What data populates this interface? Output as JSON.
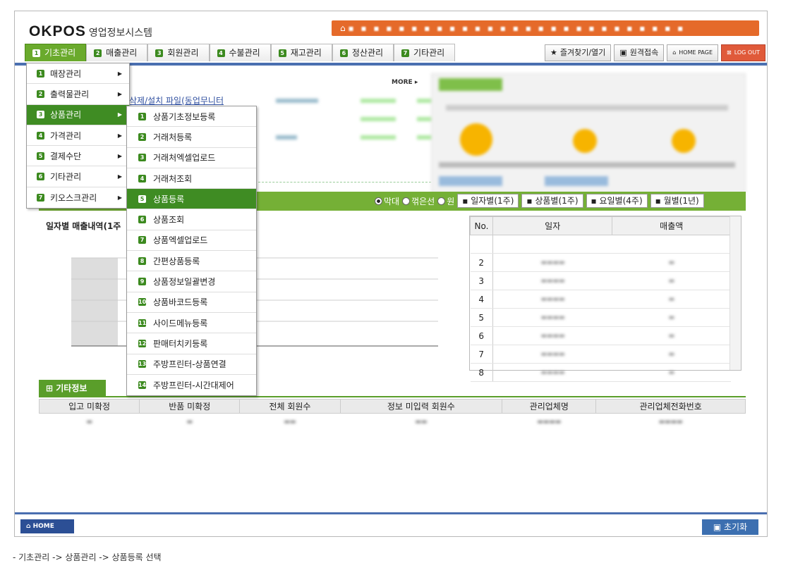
{
  "header": {
    "logo": "OKPOS",
    "subtitle": "영업정보시스템",
    "notice": "▪ ▪ ▪ ▪ ▪ ▪ ▪ ▪ ▪ ▪ ▪ ▪ ▪ ▪ ▪ ▪ ▪ ▪ ▪ ▪ ▪ ▪ ▪ ▪ ▪ ▪ ▪"
  },
  "tabs": [
    {
      "num": "1",
      "label": "기초관리"
    },
    {
      "num": "2",
      "label": "매출관리"
    },
    {
      "num": "3",
      "label": "회원관리"
    },
    {
      "num": "4",
      "label": "수불관리"
    },
    {
      "num": "5",
      "label": "재고관리"
    },
    {
      "num": "6",
      "label": "정산관리"
    },
    {
      "num": "7",
      "label": "기타관리"
    }
  ],
  "toolbar": {
    "favorites": "즐겨찾기/열기",
    "remote": "원격접속",
    "homepage": "HOME PAGE",
    "logout": "LOG OUT"
  },
  "menu1": [
    {
      "num": "1",
      "label": "매장관리"
    },
    {
      "num": "2",
      "label": "출력물관리"
    },
    {
      "num": "3",
      "label": "상품관리"
    },
    {
      "num": "4",
      "label": "가격관리"
    },
    {
      "num": "5",
      "label": "결제수단"
    },
    {
      "num": "6",
      "label": "기타관리"
    },
    {
      "num": "7",
      "label": "키오스크관리"
    }
  ],
  "menu2": [
    {
      "num": "1",
      "label": "상품기초정보등록"
    },
    {
      "num": "2",
      "label": "거래처등록"
    },
    {
      "num": "3",
      "label": "거래처엑셀업로드"
    },
    {
      "num": "4",
      "label": "거래처조회"
    },
    {
      "num": "5",
      "label": "상품등록"
    },
    {
      "num": "6",
      "label": "상품조회"
    },
    {
      "num": "7",
      "label": "상품엑셀업로드"
    },
    {
      "num": "8",
      "label": "간편상품등록"
    },
    {
      "num": "9",
      "label": "상품정보일괄변경"
    },
    {
      "num": "10",
      "label": "상품바코드등록"
    },
    {
      "num": "11",
      "label": "사이드메뉴등록"
    },
    {
      "num": "12",
      "label": "판매터치키등록"
    },
    {
      "num": "13",
      "label": "주방프린터-상품연결"
    },
    {
      "num": "14",
      "label": "주방프린터-시간대제어"
    }
  ],
  "notice_area": {
    "more": "MORE ▸",
    "link": "삭제/설치 파일(동업무니터"
  },
  "chart_opts": {
    "bar": "막대",
    "line": "꺾은선",
    "pie": "원",
    "btn1": "일자별(1주)",
    "btn2": "상품별(1주)",
    "btn3": "요일별(4주)",
    "btn4": "월별(1년)"
  },
  "chart_title": "일자별 매출내역(1주",
  "grid": {
    "headers": [
      "No.",
      "일자",
      "매출액"
    ],
    "rows": [
      "2",
      "3",
      "4",
      "5",
      "6",
      "7",
      "8"
    ]
  },
  "etc": {
    "tab": "기타정보",
    "headers": [
      "입고 미확정",
      "반품 미확정",
      "전체 회원수",
      "정보 미입력 회원수",
      "관리업체명",
      "관리업체전화번호"
    ]
  },
  "bottom": {
    "home": "HOME",
    "reset": "초기화"
  },
  "caption": "- 기초관리 -> 상품관리 -> 상품등록 선택",
  "colors": {
    "accent_green": "#3f8c23",
    "notice_orange": "#e56a2a",
    "bar_blue": "#4a6fb0"
  }
}
